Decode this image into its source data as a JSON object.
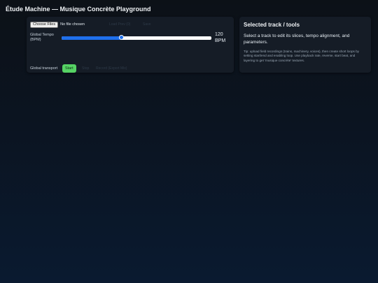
{
  "app": {
    "title": "Étude Machine — Musique Concrète Playground"
  },
  "controls": {
    "choose_files_label": "Choose Files",
    "file_status": "No file chosen",
    "load_label": "Load Prev (0)",
    "save_label": "Save",
    "tempo_label": "Global Tempo (BPM)",
    "tempo_bpm": 120,
    "tempo_min": 40,
    "tempo_max": 240,
    "tempo_value_text": "120 BPM",
    "transport_label": "Global transport",
    "start_label": "Start",
    "stop_label": "Stop",
    "record_label": "Record (Export Mix)"
  },
  "tools_panel": {
    "title": "Selected track / tools",
    "description": "Select a track to edit its slices, tempo alignment, and parameters.",
    "tip": "Tip: upload field recordings (trains, machinery, voices), then create short loops by setting start/end and enabling loop. Use playback rate, reverse, start beat, and layering to get 'musique concrète' textures."
  },
  "colors": {
    "accent": "#1f6feb",
    "start_green": "#56d364",
    "panel_bg": "#151c26",
    "page_bg": "#0c1117"
  }
}
